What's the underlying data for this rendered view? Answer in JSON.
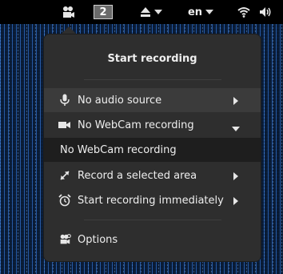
{
  "topbar": {
    "workspace_number": "2",
    "language": "en",
    "icons": [
      "screencast-icon",
      "eject-icon",
      "wifi-icon",
      "volume-icon"
    ]
  },
  "menu": {
    "title": "Start recording",
    "items": [
      {
        "label": "No audio source",
        "icon": "microphone-icon"
      },
      {
        "label": "No WebCam recording",
        "icon": "webcam-icon"
      },
      {
        "label": "Record a selected area",
        "icon": "area-select-icon"
      },
      {
        "label": "Start recording immediately",
        "icon": "alarm-clock-icon"
      },
      {
        "label": "Options",
        "icon": "options-icon"
      }
    ],
    "webcam_submenu": {
      "selected": "No WebCam recording"
    }
  },
  "colors": {
    "menu_bg": "#2e2e2e",
    "menu_hover": "#3b3b3b",
    "submenu_bg": "#1e1e1e",
    "topbar_bg": "#000000",
    "text": "#eeeeee"
  }
}
